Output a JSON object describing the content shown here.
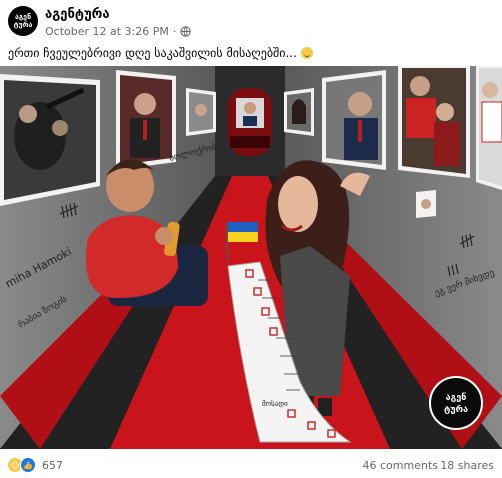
{
  "post": {
    "page_name": "აგენტურა",
    "avatar_text_top": "აგენ",
    "avatar_text_bottom": "ტურა",
    "timestamp": "October 12 at 3:26 PM",
    "caption": "ერთი ჩვეულებრივი დღე საკაშვილის მისაღებში..."
  },
  "artwork": {
    "wall_scrawl_1": "ბოლოქრის",
    "wall_scrawl_2": "miha\nHamoki",
    "wall_scrawl_3": "რაბია ზოგის",
    "wall_scrawl_4": "ეგ ვერ მიხვდე",
    "logo_top": "აგენ",
    "logo_bottom": "ტურა",
    "list_signature": "მოსადი"
  },
  "footer": {
    "reaction_count": "657",
    "comments": "46 comments",
    "shares": "18 shares"
  },
  "colors": {
    "carpet": "#c8141a",
    "wall": "#6e6e6e",
    "shirt": "#d22a2a",
    "flag_blue": "#1f5fc4",
    "flag_yellow": "#f6d21c"
  }
}
